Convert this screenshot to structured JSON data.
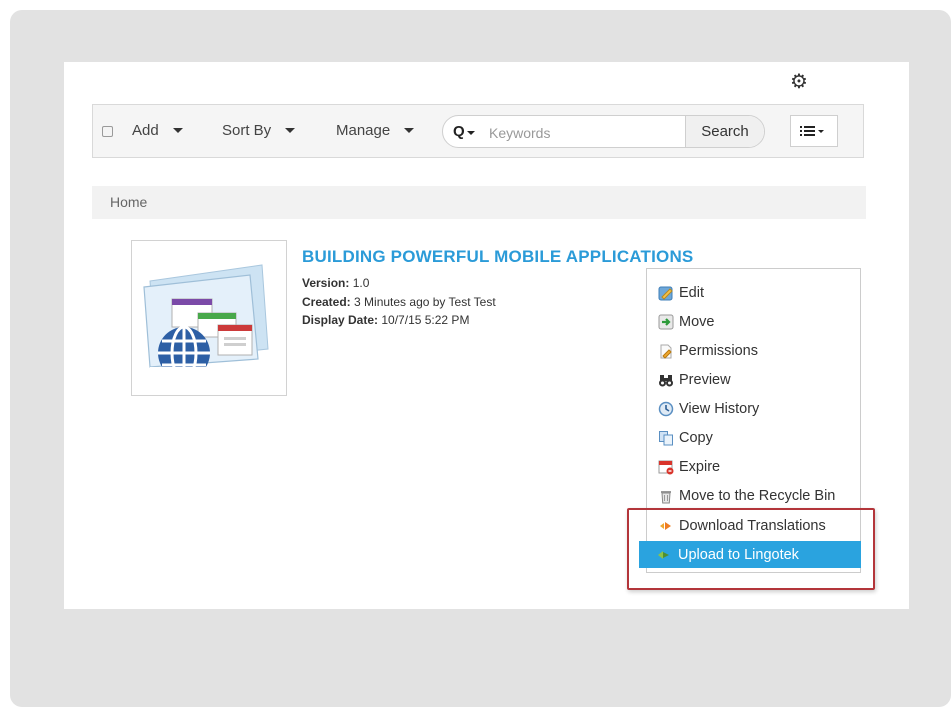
{
  "toolbar": {
    "add_label": "Add",
    "sort_label": "Sort By",
    "manage_label": "Manage",
    "search_placeholder": "Keywords",
    "search_value": "",
    "search_button_label": "Search",
    "search_prefix_glyph": "Q"
  },
  "breadcrumb": {
    "home": "Home"
  },
  "item": {
    "title": "BUILDING POWERFUL MOBILE APPLICATIONS",
    "version_label": "Version:",
    "version_value": "1.0",
    "created_label": "Created:",
    "created_value": "3 Minutes ago by Test Test",
    "display_date_label": "Display Date:",
    "display_date_value": "10/7/15 5:22 PM"
  },
  "context_menu": {
    "items": [
      {
        "label": "Edit",
        "icon": "edit-icon"
      },
      {
        "label": "Move",
        "icon": "move-icon"
      },
      {
        "label": "Permissions",
        "icon": "permissions-icon"
      },
      {
        "label": "Preview",
        "icon": "binoculars-icon"
      },
      {
        "label": "View History",
        "icon": "history-icon"
      },
      {
        "label": "Copy",
        "icon": "copy-icon"
      },
      {
        "label": "Expire",
        "icon": "calendar-icon"
      },
      {
        "label": "Move to the Recycle Bin",
        "icon": "trash-icon"
      },
      {
        "label": "Download Translations",
        "icon": "download-translations-icon"
      },
      {
        "label": "Upload to Lingotek",
        "icon": "upload-lingotek-icon",
        "active": true
      }
    ]
  },
  "colors": {
    "accent": "#2aa3df",
    "title": "#2b9bd8",
    "highlight_border": "#b3353a"
  }
}
